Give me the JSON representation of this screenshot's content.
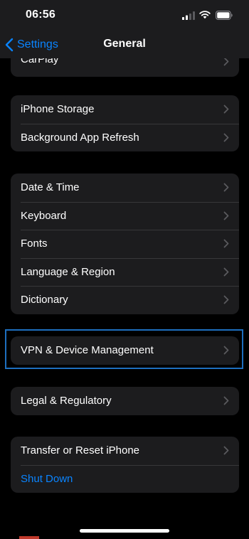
{
  "status": {
    "time": "06:56",
    "icons": [
      "signal-icon",
      "wifi-icon",
      "battery-icon"
    ]
  },
  "nav": {
    "back_label": "Settings",
    "title": "General"
  },
  "groups": {
    "partial": {
      "items": [
        "CarPlay"
      ]
    },
    "storage": {
      "items": [
        "iPhone Storage",
        "Background App Refresh"
      ]
    },
    "locale": {
      "items": [
        "Date & Time",
        "Keyboard",
        "Fonts",
        "Language & Region",
        "Dictionary"
      ]
    },
    "vpn": {
      "items": [
        "VPN & Device Management"
      ]
    },
    "legal": {
      "items": [
        "Legal & Regulatory"
      ]
    },
    "reset": {
      "items": [
        "Transfer or Reset iPhone",
        "Shut Down"
      ]
    }
  },
  "colors": {
    "accent": "#0a84ff",
    "background": "#000000",
    "cell": "#1c1c1e",
    "highlight": "#1d6fbf"
  }
}
